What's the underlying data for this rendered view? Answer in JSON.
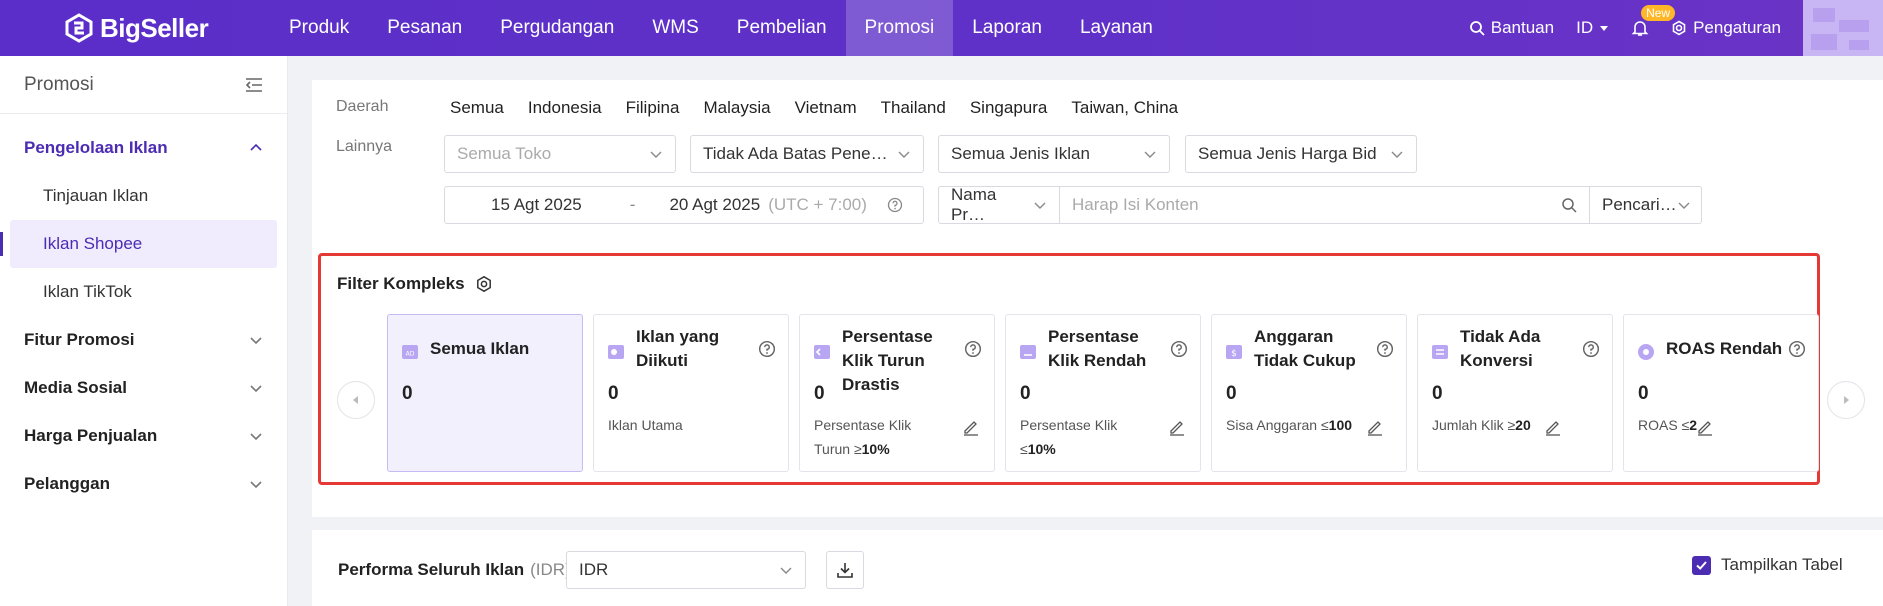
{
  "brand": {
    "name": "BigSeller"
  },
  "nav": {
    "items": [
      {
        "label": "Produk"
      },
      {
        "label": "Pesanan"
      },
      {
        "label": "Pergudangan"
      },
      {
        "label": "WMS"
      },
      {
        "label": "Pembelian"
      },
      {
        "label": "Promosi",
        "active": true
      },
      {
        "label": "Laporan"
      },
      {
        "label": "Layanan"
      }
    ],
    "help_label": "Bantuan",
    "lang_label": "ID",
    "new_badge": "New",
    "settings_label": "Pengaturan"
  },
  "sidebar": {
    "title": "Promosi",
    "groups": [
      {
        "label": "Pengelolaan Iklan",
        "children": [
          "Tinjauan Iklan",
          "Iklan Shopee",
          "Iklan TikTok"
        ],
        "active_child": "Iklan Shopee"
      },
      {
        "label": "Fitur Promosi"
      },
      {
        "label": "Media Sosial"
      },
      {
        "label": "Harga Penjualan"
      },
      {
        "label": "Pelanggan"
      }
    ]
  },
  "filters": {
    "region_label": "Daerah",
    "other_label": "Lainnya",
    "regions": [
      "Semua",
      "Indonesia",
      "Filipina",
      "Malaysia",
      "Vietnam",
      "Thailand",
      "Singapura",
      "Taiwan, China"
    ],
    "store_placeholder": "Semua Toko",
    "budget_select": "Tidak Ada Batas Pene…",
    "ad_type_select": "Semua Jenis Iklan",
    "bid_type_select": "Semua Jenis Harga Bid",
    "date_start": "15 Agt 2025",
    "date_sep": "-",
    "date_end": "20 Agt 2025",
    "timezone": "(UTC + 7:00)",
    "search_field_select": "Nama Pr…",
    "search_placeholder": "Harap Isi Konten",
    "search_mode_select": "Pencari…"
  },
  "complex_filter": {
    "title": "Filter Kompleks",
    "cards": [
      {
        "title": "Semua Iklan",
        "count": "0",
        "desc": ""
      },
      {
        "title": "Iklan yang Diikuti",
        "count": "0",
        "desc": "Iklan Utama"
      },
      {
        "title": "Persentase Klik Turun Drastis",
        "count": "0",
        "desc": "Persentase Klik Turun ≥",
        "desc_value": "10%"
      },
      {
        "title": "Persentase Klik Rendah",
        "count": "0",
        "desc": "Persentase Klik ≤",
        "desc_value": "10%"
      },
      {
        "title": "Anggaran Tidak Cukup",
        "count": "0",
        "desc": "Sisa Anggaran ≤",
        "desc_value": "100"
      },
      {
        "title": "Tidak Ada Konversi",
        "count": "0",
        "desc": "Jumlah Klik ≥",
        "desc_value": "20"
      },
      {
        "title": "ROAS Rendah",
        "count": "0",
        "desc": "ROAS ≤",
        "desc_value": "2"
      }
    ]
  },
  "performance": {
    "title": "Performa Seluruh Iklan",
    "currency_note": "(IDR)",
    "currency_select": "IDR",
    "show_table_label": "Tampilkan Tabel",
    "show_table_checked": true
  },
  "colors": {
    "primary": "#4b2cb3",
    "nav_bg": "#5b2ec9",
    "highlight_border": "#e53935",
    "badge": "#ffb627"
  }
}
